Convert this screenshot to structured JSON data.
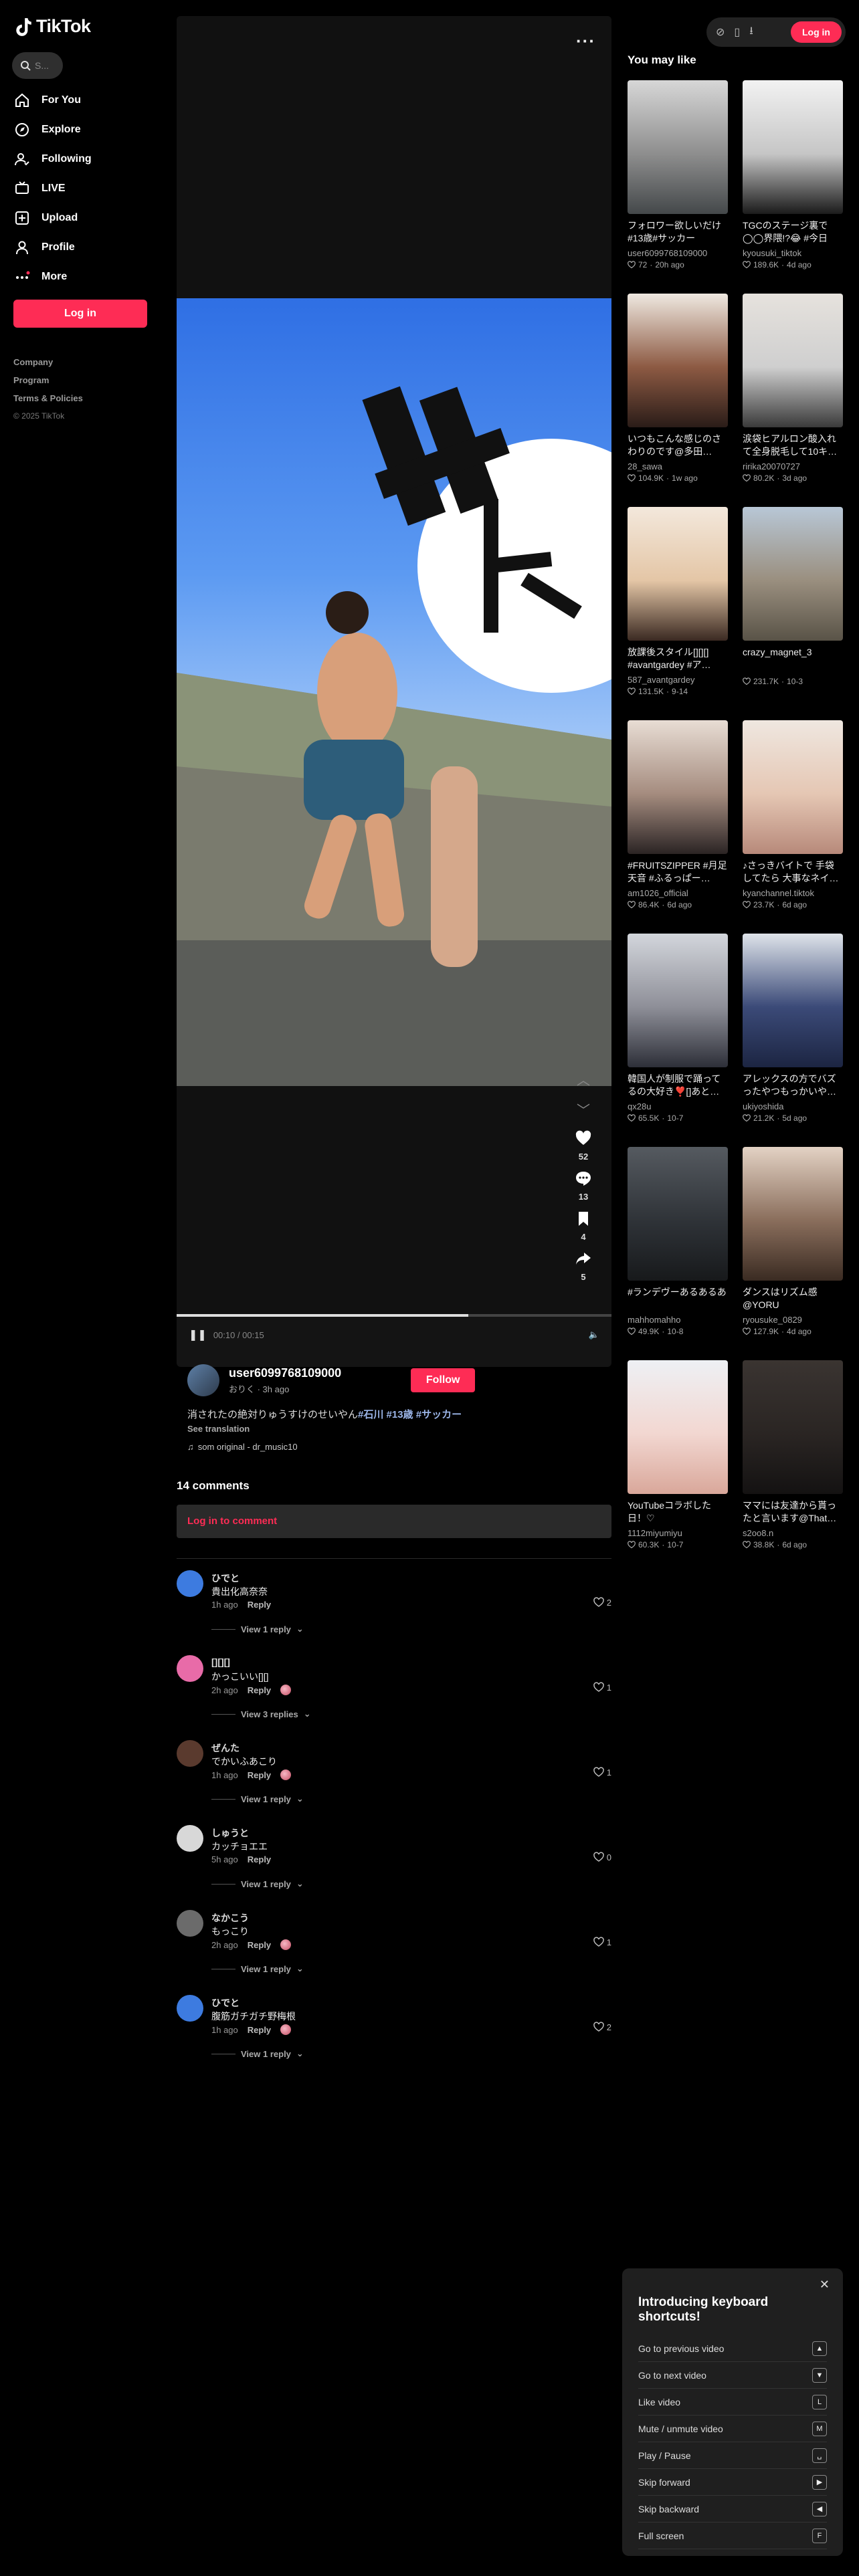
{
  "logo": {
    "text": "TikTok"
  },
  "search": {
    "placeholder": "S..."
  },
  "nav": [
    {
      "label": "For You",
      "icon": "home-icon"
    },
    {
      "label": "Explore",
      "icon": "compass-icon"
    },
    {
      "label": "Following",
      "icon": "following-icon"
    },
    {
      "label": "LIVE",
      "icon": "live-icon"
    },
    {
      "label": "Upload",
      "icon": "upload-icon"
    },
    {
      "label": "Profile",
      "icon": "profile-icon"
    },
    {
      "label": "More",
      "icon": "more-icon"
    }
  ],
  "sidebar": {
    "login_label": "Log in",
    "links": [
      "Company",
      "Program",
      "Terms & Policies"
    ],
    "copyright": "© 2025 TikTok"
  },
  "topbar": {
    "login_label": "Log in"
  },
  "video": {
    "progress_fraction": 0.67,
    "time": "00:10 / 00:15",
    "likes": "52",
    "comments": "13",
    "saves": "4",
    "shares": "5"
  },
  "author": {
    "name": "user6099768109000",
    "sub": "おりく · 3h ago",
    "follow_label": "Follow",
    "caption_text": "消されたの絶対りゅうすけのせいやん",
    "caption_tags": [
      "#石川",
      "#13歳",
      "#サッカー"
    ],
    "see_translation": "See translation",
    "music": "som original - dr_music10"
  },
  "comments": {
    "title": "14 comments",
    "login_prompt": "Log in to comment",
    "items": [
      {
        "name": "ひでと",
        "text": "貴出化高奈奈",
        "time": "1h ago",
        "reply": "Reply",
        "likes": "2",
        "view": "View 1 reply",
        "avatar_color": "#3d7be0",
        "author_liked": false
      },
      {
        "name": "[][][]",
        "text": "かっこいい[][]",
        "time": "2h ago",
        "reply": "Reply",
        "likes": "1",
        "view": "View 3 replies",
        "avatar_color": "#e86ba8",
        "author_liked": true
      },
      {
        "name": "ぜんた",
        "text": "でかいふあこり",
        "time": "1h ago",
        "reply": "Reply",
        "likes": "1",
        "view": "View 1 reply",
        "avatar_color": "#5a3a2e",
        "author_liked": true
      },
      {
        "name": "しゅうと",
        "text": "カッチョエエ",
        "time": "5h ago",
        "reply": "Reply",
        "likes": "0",
        "view": "View 1 reply",
        "avatar_color": "#d8d8d8",
        "author_liked": false
      },
      {
        "name": "なかこう",
        "text": "もっこり",
        "time": "2h ago",
        "reply": "Reply",
        "likes": "1",
        "view": "View 1 reply",
        "avatar_color": "#6b6b6b",
        "author_liked": true
      },
      {
        "name": "ひでと",
        "text": "腹筋ガチガチ野梅根",
        "time": "1h ago",
        "reply": "Reply",
        "likes": "2",
        "view": "View 1 reply",
        "avatar_color": "#3d7be0",
        "author_liked": true
      }
    ]
  },
  "you_may_like": {
    "title": "You may like",
    "items": [
      {
        "title": "フォロワー欲しいだけ #13歳#サッカー",
        "user": "user6099768109000",
        "likes": "72",
        "time": "20h ago",
        "colors": [
          "#d7d7d7",
          "#8e8e8e",
          "#44484a"
        ]
      },
      {
        "title": "TGCのステージ裏で◯◯界隈!?😂 #今日好…",
        "user": "kyousuki_tiktok",
        "likes": "189.6K",
        "time": "4d ago",
        "colors": [
          "#f2f2f2",
          "#c6c6c6",
          "#1b1b1b"
        ]
      },
      {
        "title": "いつもこんな感じのさわりのです@多田…",
        "user": "28_sawa",
        "likes": "104.9K",
        "time": "1w ago",
        "colors": [
          "#efe9e1",
          "#8d5a43",
          "#2a1c18"
        ]
      },
      {
        "title": "涙袋ヒアルロン酸入れて全身脱毛して10キ…",
        "user": "ririka20070727",
        "likes": "80.2K",
        "time": "3d ago",
        "colors": [
          "#e6e2dd",
          "#cfcfcf",
          "#3a3a3a"
        ]
      },
      {
        "title": "放課後スタイル[][][] #avantgardey #ア…",
        "user": "587_avantgardey",
        "likes": "131.5K",
        "time": "9-14",
        "colors": [
          "#f3e8dc",
          "#e4c6a6",
          "#3b2a22"
        ]
      },
      {
        "title": "crazy_magnet_3",
        "user": "",
        "likes": "231.7K",
        "time": "10-3",
        "colors": [
          "#b8c7d6",
          "#9a8f7f",
          "#595347"
        ]
      },
      {
        "title": "#FRUITSZIPPER #月足天音 #ふるっぱー…",
        "user": "am1026_official",
        "likes": "86.4K",
        "time": "6d ago",
        "colors": [
          "#e8ddd4",
          "#a58c7f",
          "#2b2424"
        ]
      },
      {
        "title": "♪さっきバイトで 手袋してたら 大事なネイ…",
        "user": "kyanchannel.tiktok",
        "likes": "23.7K",
        "time": "6d ago",
        "colors": [
          "#efe7e0",
          "#e5c7b4",
          "#b7897a"
        ]
      },
      {
        "title": "韓国人が制服で踊ってるの大好き❣️[]あと…",
        "user": "qx28u",
        "likes": "65.5K",
        "time": "10-7",
        "colors": [
          "#d3d6dc",
          "#8e8f98",
          "#2d2f38"
        ]
      },
      {
        "title": "アレックスの方でバズったやつもっかいや…",
        "user": "ukiyoshida",
        "likes": "21.2K",
        "time": "5d ago",
        "colors": [
          "#dfe4ea",
          "#3b4a78",
          "#1c2542"
        ]
      },
      {
        "title": "#ランデヴーあるあるあ",
        "user": "mahhomahho",
        "likes": "49.9K",
        "time": "10-8",
        "colors": [
          "#555a60",
          "#2f3338",
          "#17191b"
        ]
      },
      {
        "title": "ダンスはリズム感 @YORU",
        "user": "ryousuke_0829",
        "likes": "127.9K",
        "time": "4d ago",
        "colors": [
          "#e3d2c4",
          "#8a6e5c",
          "#3a2b22"
        ]
      },
      {
        "title": "YouTubeコラボした日！♡",
        "user": "1112miyumiyu",
        "likes": "60.3K",
        "time": "10-7",
        "colors": [
          "#eef0f4",
          "#f2d7d1",
          "#d9a79a"
        ]
      },
      {
        "title": "ママには友達から貰ったと言います@That…",
        "user": "s2oo8.n",
        "likes": "38.8K",
        "time": "6d ago",
        "colors": [
          "#3a3431",
          "#2a2523",
          "#141212"
        ]
      }
    ]
  },
  "shortcuts": {
    "title": "Introducing keyboard shortcuts!",
    "items": [
      {
        "label": "Go to previous video",
        "key": "▲"
      },
      {
        "label": "Go to next video",
        "key": "▼"
      },
      {
        "label": "Like video",
        "key": "L"
      },
      {
        "label": "Mute / unmute video",
        "key": "M"
      },
      {
        "label": "Play / Pause",
        "key": "␣"
      },
      {
        "label": "Skip forward",
        "key": "▶"
      },
      {
        "label": "Skip backward",
        "key": "◀"
      },
      {
        "label": "Full screen",
        "key": "F"
      }
    ]
  },
  "colors": {
    "accent": "#fe2c55",
    "bg": "#000000",
    "panel": "#141414"
  }
}
